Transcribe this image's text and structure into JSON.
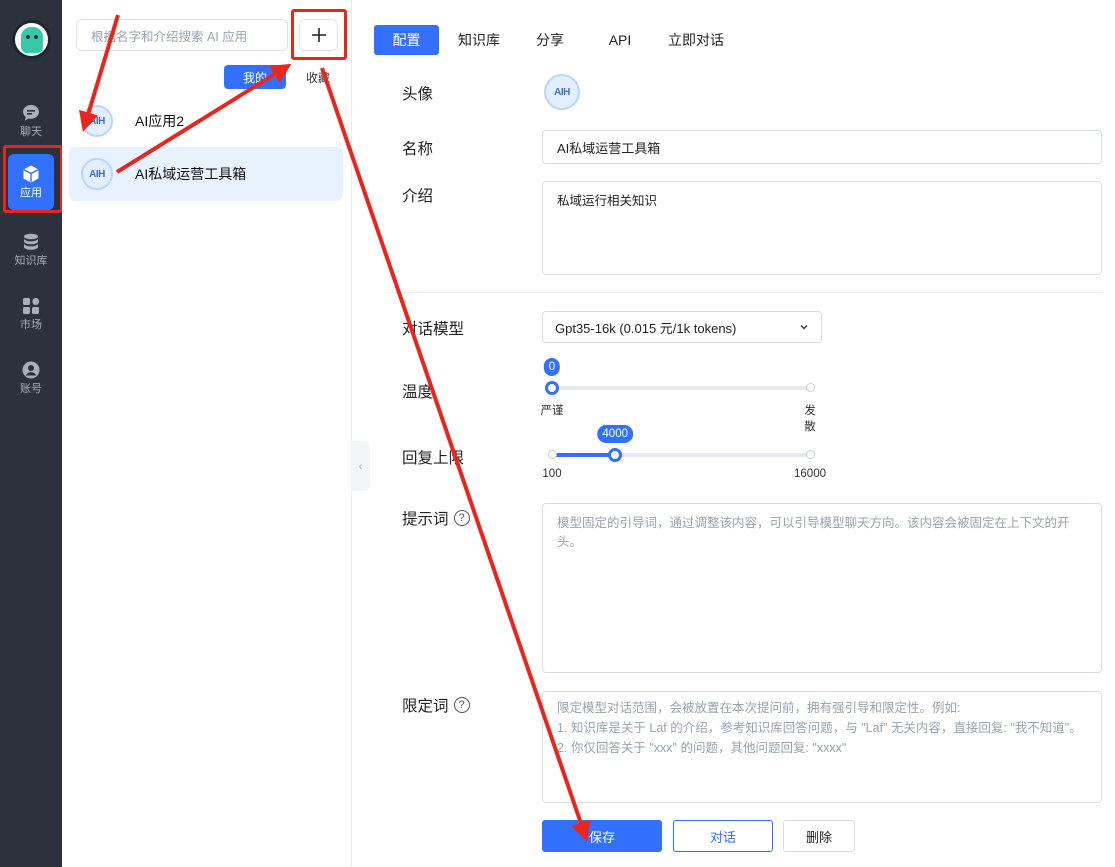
{
  "nav": {
    "items": [
      {
        "label": "聊天",
        "icon": "chat-icon",
        "active": false
      },
      {
        "label": "应用",
        "icon": "cube-icon",
        "active": true
      },
      {
        "label": "知识库",
        "icon": "database-icon",
        "active": false
      },
      {
        "label": "市场",
        "icon": "grid-icon",
        "active": false
      },
      {
        "label": "账号",
        "icon": "user-icon",
        "active": false
      }
    ]
  },
  "applist": {
    "search_placeholder": "根据名字和介绍搜索 AI 应用",
    "add_label": "+",
    "filter_mine": "我的",
    "filter_fav": "收藏",
    "items": [
      {
        "name": "AI应用2",
        "avatar_text": "AIH"
      },
      {
        "name": "AI私域运营工具箱",
        "avatar_text": "AIH",
        "selected": true
      }
    ]
  },
  "tabs": [
    "配置",
    "知识库",
    "分享",
    "API",
    "立即对话"
  ],
  "form": {
    "avatar_label": "头像",
    "avatar_text": "AIH",
    "name_label": "名称",
    "name_value": "AI私域运营工具箱",
    "intro_label": "介绍",
    "intro_value": "私域运行相关知识",
    "model_label": "对话模型",
    "model_value": "Gpt35-16k (0.015 元/1k tokens)",
    "temperature_label": "温度",
    "temperature_value": "0",
    "temperature_fraction": 0,
    "temperature_min_label": "严谨",
    "temperature_max_label": "发散",
    "max_reply_label": "回复上限",
    "max_reply_value": "4000",
    "max_reply_min": "100",
    "max_reply_max": "16000",
    "max_reply_fraction": 0.245,
    "prompt_label": "提示词",
    "prompt_placeholder": "模型固定的引导词，通过调整该内容，可以引导模型聊天方向。该内容会被固定在上下文的开头。",
    "limit_label": "限定词",
    "limit_placeholder_lines": [
      "限定模型对话范围，会被放置在本次提问前，拥有强引导和限定性。例如:",
      "1. 知识库是关于 Laf 的介绍，参考知识库回答问题，与 \"Laf\" 无关内容，直接回复: \"我不知道\"。",
      "2. 你仅回答关于 \"xxx\" 的问题，其他问题回复: \"xxxx\""
    ]
  },
  "actions": {
    "save": "保存",
    "chat": "对话",
    "delete": "删除"
  },
  "colors": {
    "primary": "#3370ff",
    "nav_bg": "#2b323c",
    "annotation": "#e8261d"
  }
}
